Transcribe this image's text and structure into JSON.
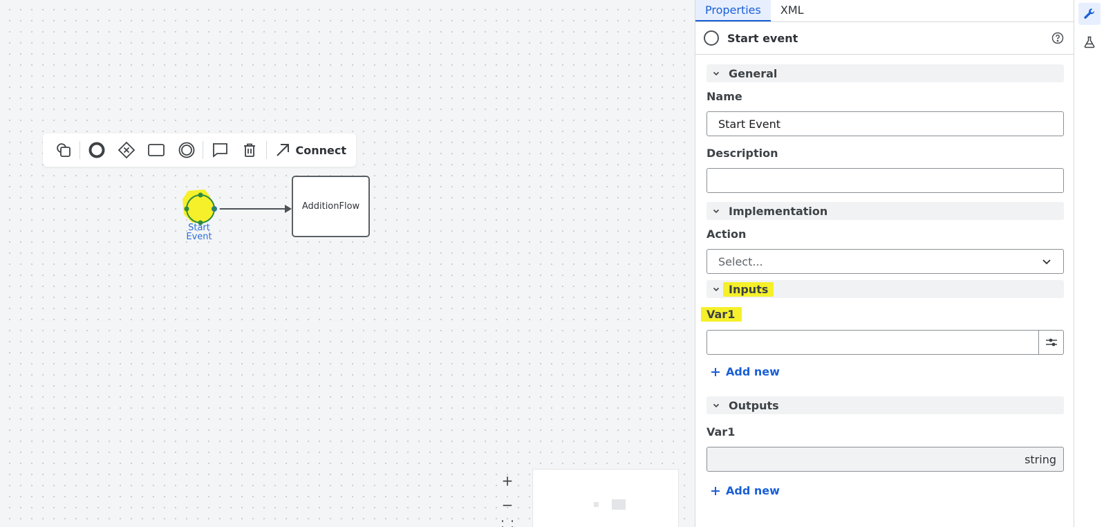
{
  "toolbar": {
    "connect_label": "Connect",
    "icons": [
      "append-shapes-icon",
      "end-event-icon",
      "gateway-icon",
      "task-icon",
      "intermediate-event-icon",
      "annotation-icon",
      "delete-icon",
      "connect-arrow-icon"
    ]
  },
  "diagram": {
    "start_event_label_line1": "Start",
    "start_event_label_line2": "Event",
    "task_label": "AdditionFlow",
    "highlight_color": "#f5f02a",
    "accent_color": "#1a5fd6"
  },
  "zoom": {
    "zoom_in": "+",
    "zoom_out": "−"
  },
  "panel": {
    "tabs": [
      {
        "label": "Properties",
        "active": true
      },
      {
        "label": "XML",
        "active": false
      }
    ],
    "element_title": "Start event",
    "groups": {
      "general": "General",
      "implementation": "Implementation",
      "inputs": "Inputs",
      "outputs": "Outputs"
    },
    "name_label": "Name",
    "name_value": "Start Event",
    "description_label": "Description",
    "description_value": "",
    "action_label": "Action",
    "action_placeholder": "Select...",
    "inputs": {
      "var_label": "Var1",
      "var_value": "",
      "add_new": "Add new"
    },
    "outputs": {
      "var_label": "Var1",
      "var_type": "string",
      "add_new": "Add new"
    }
  }
}
